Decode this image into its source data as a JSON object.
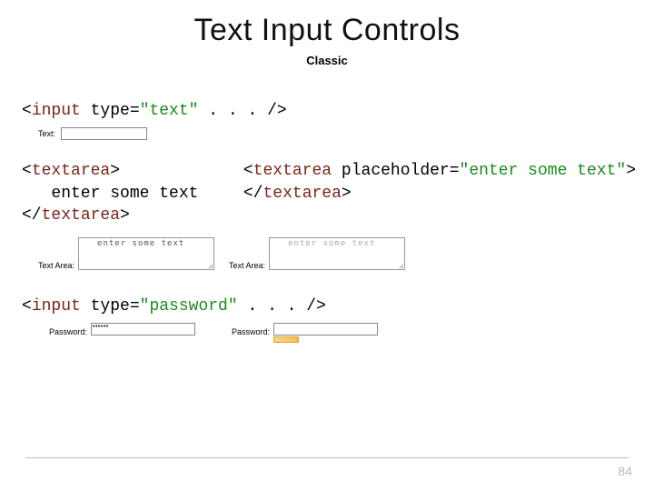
{
  "title": "Text Input Controls",
  "subtitle": "Classic",
  "code_blocks": {
    "input_text": {
      "open_lt": "<",
      "tag": "input",
      "mid": " type=",
      "val_q": "\"text\"",
      "tail": " . . . />"
    },
    "textarea_left": {
      "line1_open": "<",
      "line1_name": "textarea",
      "line1_close": ">",
      "line2": "   enter some text",
      "line3_open": "</",
      "line3_name": "textarea",
      "line3_close": ">"
    },
    "textarea_right": {
      "line1_open": "<",
      "line1_name": "textarea",
      "line1_mid": " placeholder=",
      "line1_val": "\"enter some text\"",
      "line1_close": ">",
      "line2_open": "</",
      "line2_name": "textarea",
      "line2_close": ">"
    },
    "input_password": {
      "open_lt": "<",
      "tag": "input",
      "mid": " type=",
      "val_q": "\"password\"",
      "tail": " . . . />"
    }
  },
  "demos": {
    "text_label": "Text:",
    "textarea_label": "Text Area:",
    "textarea_content": "enter some text",
    "textarea_placeholder": "enter some text",
    "password_label": "Password:",
    "password_mask": "••••••"
  },
  "page_number": "84"
}
